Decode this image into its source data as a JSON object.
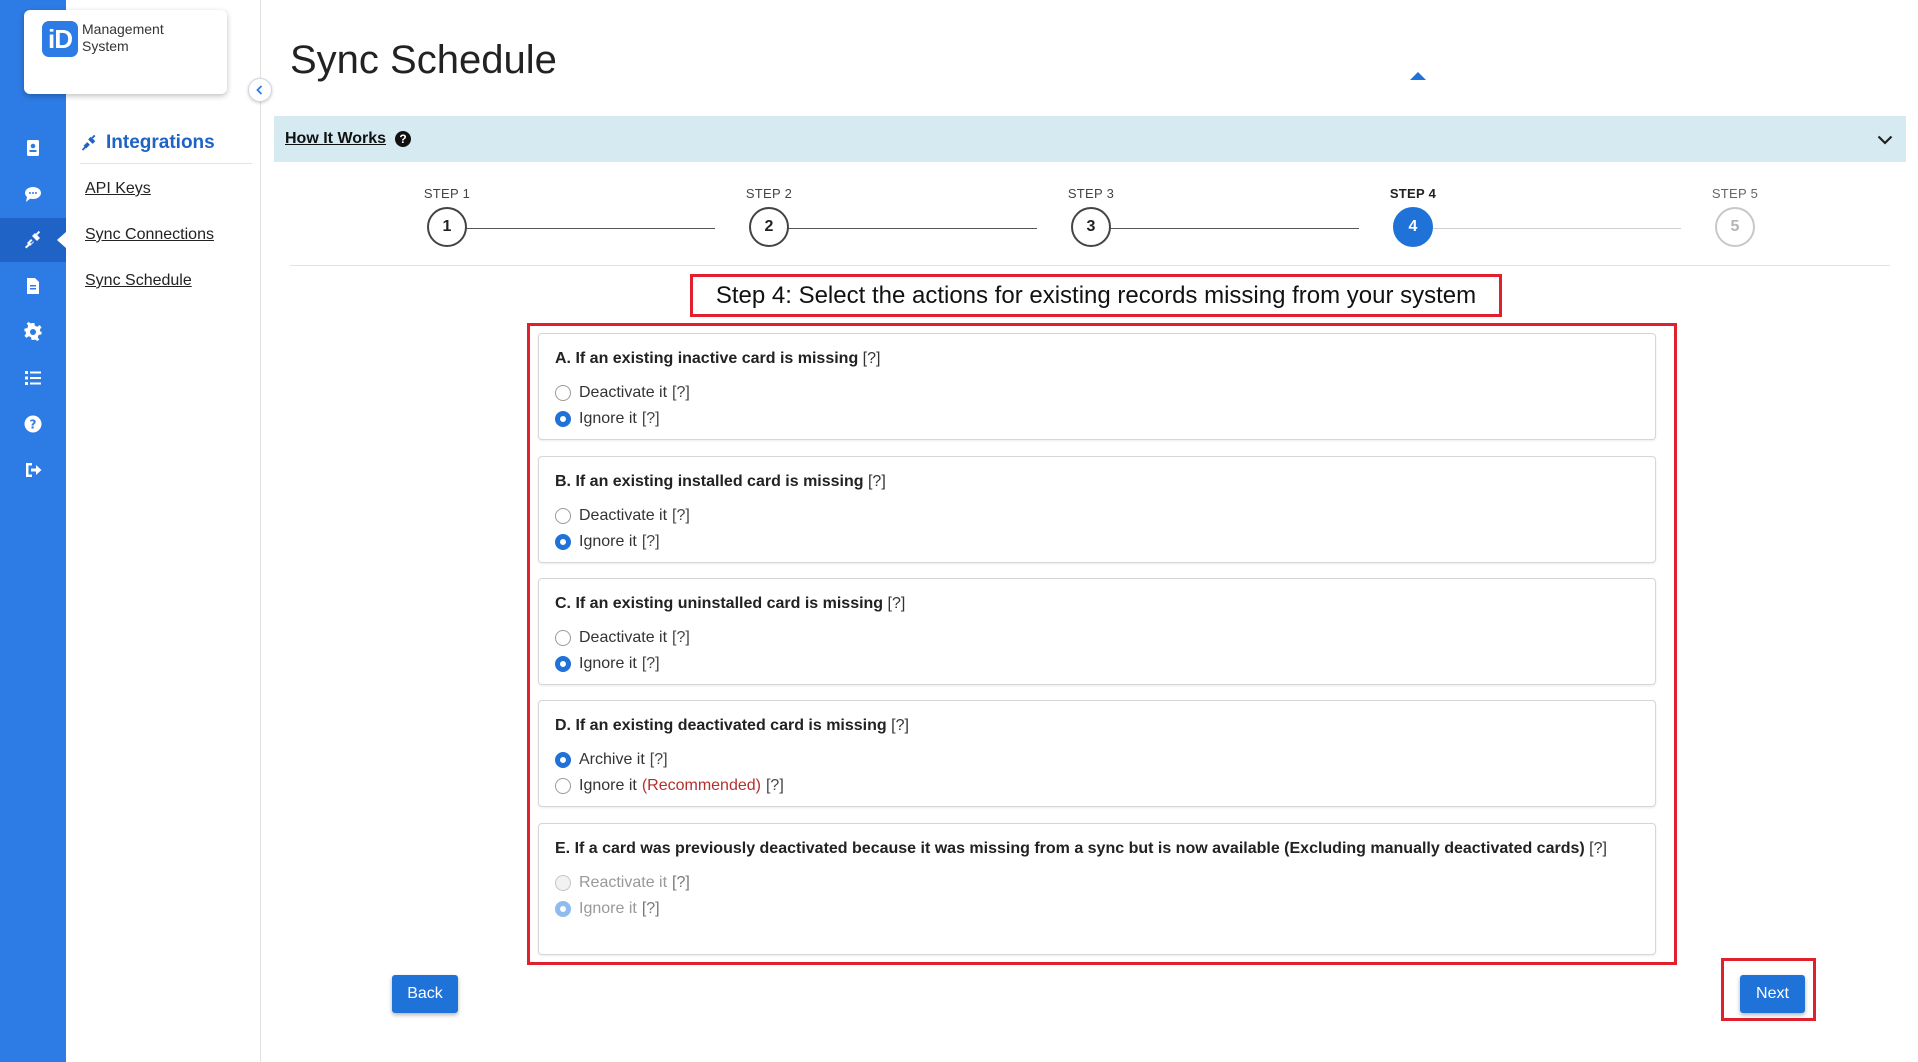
{
  "logo": {
    "mark": "iD",
    "line1": "Management",
    "line2": "System"
  },
  "rail": {
    "items": [
      {
        "name": "cards-icon"
      },
      {
        "name": "messages-icon"
      },
      {
        "name": "integrations-icon",
        "active": true
      },
      {
        "name": "documents-icon"
      },
      {
        "name": "settings-icon"
      },
      {
        "name": "list-icon"
      },
      {
        "name": "help-icon"
      },
      {
        "name": "logout-icon"
      }
    ]
  },
  "subnav": {
    "header": "Integrations",
    "links": [
      "API Keys",
      "Sync Connections",
      "Sync Schedule"
    ]
  },
  "page": {
    "title": "Sync Schedule"
  },
  "how_it_works": {
    "label": "How It Works",
    "help_glyph": "?"
  },
  "stepper": {
    "steps": [
      {
        "label": "STEP 1",
        "number": "1"
      },
      {
        "label": "STEP 2",
        "number": "2"
      },
      {
        "label": "STEP 3",
        "number": "3"
      },
      {
        "label": "STEP 4",
        "number": "4"
      },
      {
        "label": "STEP 5",
        "number": "5"
      }
    ],
    "current": 4
  },
  "step_heading": "Step 4: Select the actions for existing records missing from your system",
  "questions": [
    {
      "title": "A. If an existing inactive card is missing",
      "help": "[?]",
      "options": [
        {
          "label": "Deactivate it",
          "help": "[?]",
          "checked": false
        },
        {
          "label": "Ignore it",
          "help": "[?]",
          "checked": true
        }
      ]
    },
    {
      "title": "B. If an existing installed card is missing",
      "help": "[?]",
      "options": [
        {
          "label": "Deactivate it",
          "help": "[?]",
          "checked": false
        },
        {
          "label": "Ignore it",
          "help": "[?]",
          "checked": true
        }
      ]
    },
    {
      "title": "C. If an existing uninstalled card is missing",
      "help": "[?]",
      "options": [
        {
          "label": "Deactivate it",
          "help": "[?]",
          "checked": false
        },
        {
          "label": "Ignore it",
          "help": "[?]",
          "checked": true
        }
      ]
    },
    {
      "title": "D. If an existing deactivated card is missing",
      "help": "[?]",
      "options": [
        {
          "label": "Archive it",
          "help": "[?]",
          "checked": true
        },
        {
          "label": "Ignore it",
          "note": "(Recommended)",
          "help": "[?]",
          "checked": false
        }
      ]
    },
    {
      "title": "E. If a card was previously deactivated because it was missing from a sync but is now available (Excluding manually deactivated cards)",
      "help": "[?]",
      "disabled": true,
      "options": [
        {
          "label": "Reactivate it",
          "help": "[?]",
          "checked": false
        },
        {
          "label": "Ignore it",
          "help": "[?]",
          "checked": true
        }
      ]
    }
  ],
  "buttons": {
    "back": "Back",
    "next": "Next"
  },
  "colors": {
    "primary": "#1f72d8",
    "rail": "#2d7be4",
    "highlight": "#e0202d",
    "info_bar": "#d6ebf1"
  }
}
